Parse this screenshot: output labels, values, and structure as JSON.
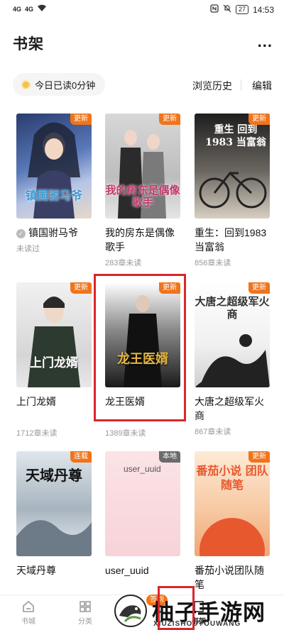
{
  "status_bar": {
    "left_icons": [
      "4G",
      "4G"
    ],
    "battery": "27",
    "time": "14:53"
  },
  "header": {
    "title": "书架",
    "more_label": "..."
  },
  "toolbar": {
    "read_today": "今日已读0分钟",
    "history": "浏览历史",
    "edit": "编辑"
  },
  "books": [
    {
      "title": "镇国驸马爷",
      "sub": "未读过",
      "badge": "更新",
      "cover_text": "镇国驸马爷",
      "checked": true
    },
    {
      "title": "我的房东是偶像歌手",
      "sub": "283章未读",
      "badge": "更新",
      "cover_text": "我的房东是偶像歌手"
    },
    {
      "title": "重生：回到1983当富翁",
      "sub": "856章未读",
      "badge": "更新",
      "cover_text": "重生 回到1983 当富翁"
    },
    {
      "title": "上门龙婿",
      "sub": "1712章未读",
      "badge": "更新",
      "cover_text": "上门龙婿"
    },
    {
      "title": "龙王医婿",
      "sub": "1389章未读",
      "badge": "更新",
      "cover_text": "龙王医婿"
    },
    {
      "title": "大唐之超级军火商",
      "sub": "867章未读",
      "badge": "更新",
      "cover_text": "大唐之超级军火商"
    },
    {
      "title": "天域丹尊",
      "sub": "",
      "badge": "连载",
      "cover_text": "天域丹尊"
    },
    {
      "title": "user_uuid",
      "sub": "",
      "badge": "本地",
      "cover_text": "user_uuid"
    },
    {
      "title": "番茄小说团队随笔",
      "sub": "",
      "badge": "更新",
      "cover_text": "番茄小说 团队随笔"
    }
  ],
  "bottom_nav": {
    "items": [
      "书城",
      "分类",
      "",
      "书架",
      ""
    ],
    "sign_badge": "签到"
  },
  "watermark": {
    "text": "柚子手游网",
    "sub": "XIUZISHOUYOUWANG"
  },
  "colors": {
    "accent": "#f0741c",
    "highlight": "#d9262b"
  }
}
